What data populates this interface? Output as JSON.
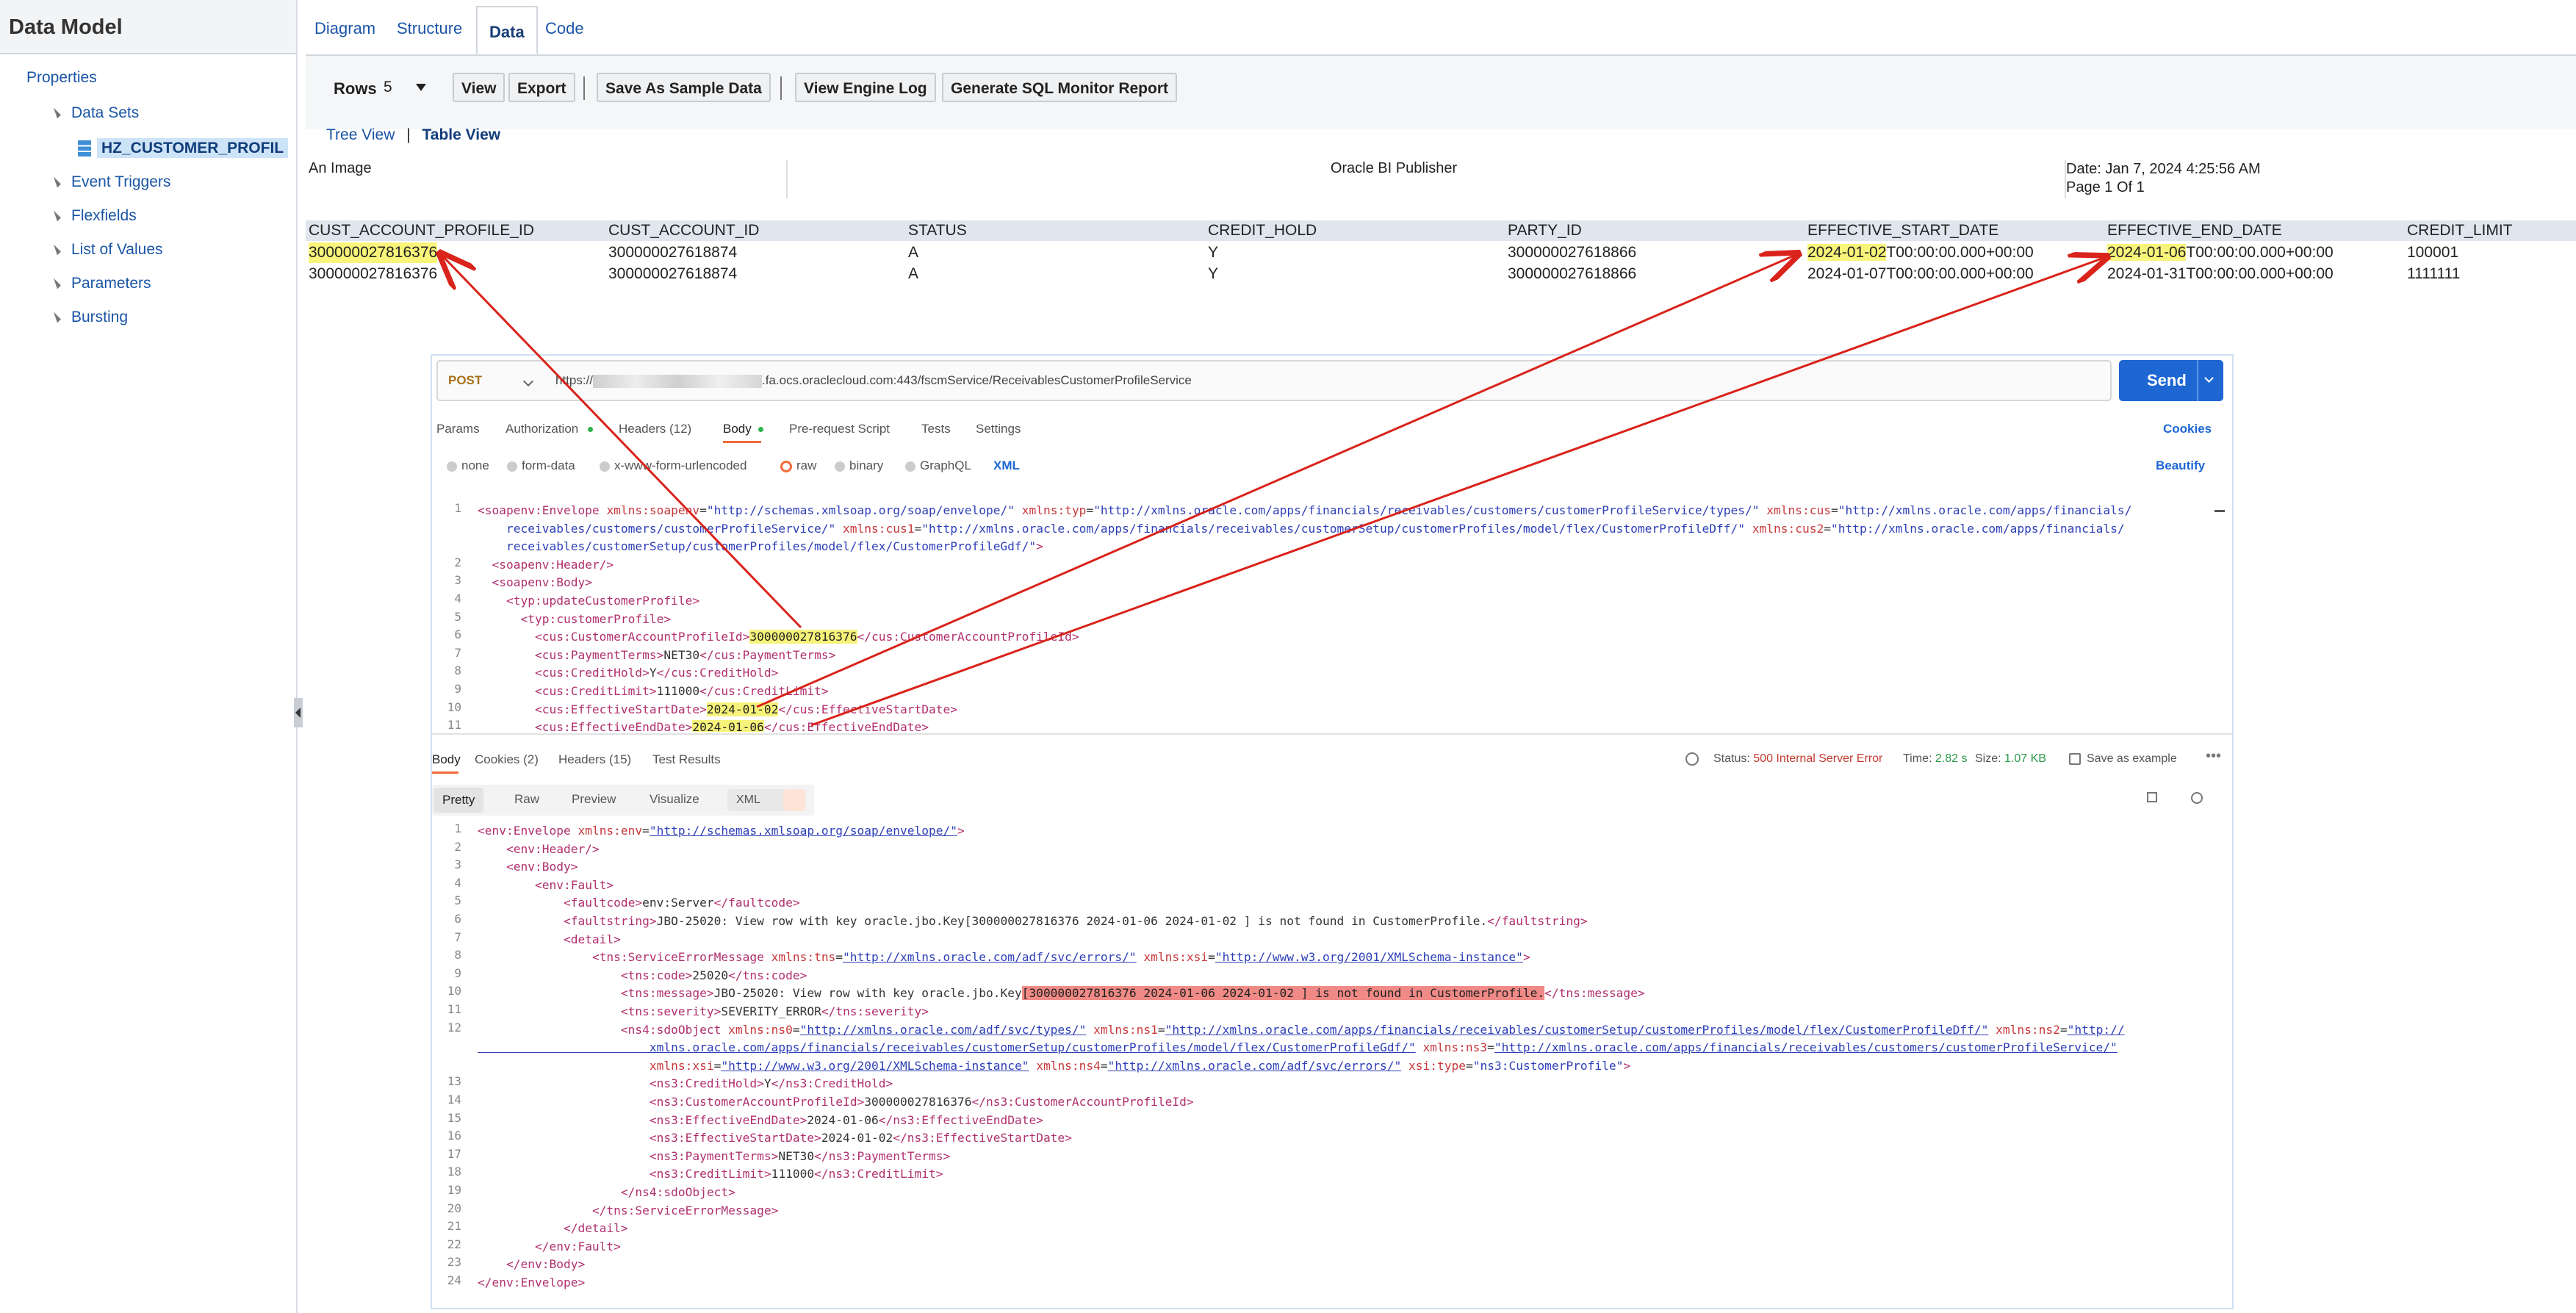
{
  "data_model": {
    "title": "Data Model",
    "properties": "Properties",
    "tree": [
      {
        "label": "Data Sets"
      },
      {
        "label": "HZ_CUSTOMER_PROFIL"
      },
      {
        "label": "Event Triggers"
      },
      {
        "label": "Flexfields"
      },
      {
        "label": "List of Values"
      },
      {
        "label": "Parameters"
      },
      {
        "label": "Bursting"
      }
    ]
  },
  "tabs": [
    "Diagram",
    "Structure",
    "Data",
    "Code"
  ],
  "toolbar": {
    "rows_label": "Rows",
    "rows_value": "5",
    "buttons": [
      "View",
      "Export",
      "Save As Sample Data",
      "View Engine Log",
      "Generate SQL Monitor Report"
    ]
  },
  "view_toggle": {
    "tree": "Tree View",
    "sep": "|",
    "table": "Table View"
  },
  "report": {
    "left": "An Image",
    "center": "Oracle BI Publisher",
    "date": "Date: Jan 7, 2024 4:25:56 AM",
    "page": "Page 1 Of 1"
  },
  "grid": {
    "headers": [
      "CUST_ACCOUNT_PROFILE_ID",
      "CUST_ACCOUNT_ID",
      "STATUS",
      "CREDIT_HOLD",
      "PARTY_ID",
      "EFFECTIVE_START_DATE",
      "EFFECTIVE_END_DATE",
      "CREDIT_LIMIT"
    ],
    "rows": [
      [
        "300000027816376",
        "300000027618874",
        "A",
        "Y",
        "300000027618866",
        "2024-01-02",
        "T00:00:00.000+00:00",
        "2024-01-06",
        "T00:00:00.000+00:00",
        "100001"
      ],
      [
        "300000027816376",
        "300000027618874",
        "A",
        "Y",
        "300000027618866",
        "2024-01-07T00:00:00.000+00:00",
        "",
        "2024-01-31T00:00:00.000+00:00",
        "",
        "1111111"
      ]
    ]
  },
  "postman": {
    "method": "POST",
    "url_prefix": "https://",
    "url_suffix": ".fa.ocs.oraclecloud.com:443/fscmService/ReceivablesCustomerProfileService",
    "send": "Send",
    "req_tabs": [
      "Params",
      "Authorization",
      "Headers (12)",
      "Body",
      "Pre-request Script",
      "Tests",
      "Settings"
    ],
    "cookies": "Cookies",
    "body_types": [
      "none",
      "form-data",
      "x-www-form-urlencoded",
      "raw",
      "binary",
      "GraphQL"
    ],
    "body_lang": "XML",
    "beautify": "Beautify",
    "resp_tabs": [
      "Body",
      "Cookies (2)",
      "Headers (15)",
      "Test Results"
    ],
    "status_label": "Status:",
    "status_value": "500 Internal Server Error",
    "time_label": "Time:",
    "time_value": "2.82 s",
    "size_label": "Size:",
    "size_value": "1.07 KB",
    "save_example": "Save as example",
    "view_tabs": [
      "Pretty",
      "Raw",
      "Preview",
      "Visualize"
    ],
    "resp_lang": "XML",
    "request_lines": [
      {
        "n": "1",
        "tokens": [
          [
            "tag",
            "<soapenv:Envelope "
          ],
          [
            "attr",
            "xmlns:soapenv"
          ],
          [
            "txt",
            "="
          ],
          [
            "val",
            "\"http://schemas.xmlsoap.org/soap/envelope/\""
          ],
          [
            "txt",
            " "
          ],
          [
            "attr",
            "xmlns:typ"
          ],
          [
            "txt",
            "="
          ],
          [
            "val",
            "\"http://xmlns.oracle.com/apps/financials/receivables/customers/customerProfileService/types/\""
          ],
          [
            "txt",
            " "
          ],
          [
            "attr",
            "xmlns:cus"
          ],
          [
            "txt",
            "="
          ],
          [
            "val",
            "\"http://xmlns.oracle.com/apps/financials/"
          ]
        ]
      },
      {
        "n": "",
        "tokens": [
          [
            "val",
            "    receivables/customers/customerProfileService/\""
          ],
          [
            "txt",
            " "
          ],
          [
            "attr",
            "xmlns:cus1"
          ],
          [
            "txt",
            "="
          ],
          [
            "val",
            "\"http://xmlns.oracle.com/apps/financials/receivables/customerSetup/customerProfiles/model/flex/CustomerProfileDff/\""
          ],
          [
            "txt",
            " "
          ],
          [
            "attr",
            "xmlns:cus2"
          ],
          [
            "txt",
            "="
          ],
          [
            "val",
            "\"http://xmlns.oracle.com/apps/financials/"
          ]
        ]
      },
      {
        "n": "",
        "tokens": [
          [
            "val",
            "    receivables/customerSetup/customerProfiles/model/flex/CustomerProfileGdf/\""
          ],
          [
            "tag",
            ">"
          ]
        ]
      },
      {
        "n": "2",
        "tokens": [
          [
            "txt",
            "  "
          ],
          [
            "tag",
            "<soapenv:Header/>"
          ]
        ]
      },
      {
        "n": "3",
        "tokens": [
          [
            "txt",
            "  "
          ],
          [
            "tag",
            "<soapenv:Body>"
          ]
        ]
      },
      {
        "n": "4",
        "tokens": [
          [
            "txt",
            "    "
          ],
          [
            "tag",
            "<typ:updateCustomerProfile>"
          ]
        ]
      },
      {
        "n": "5",
        "tokens": [
          [
            "txt",
            "      "
          ],
          [
            "tag",
            "<typ:customerProfile>"
          ]
        ]
      },
      {
        "n": "6",
        "tokens": [
          [
            "txt",
            "        "
          ],
          [
            "tag",
            "<cus:CustomerAccountProfileId>"
          ],
          [
            "hl",
            "300000027816376"
          ],
          [
            "tag",
            "</cus:CustomerAccountProfileId>"
          ]
        ]
      },
      {
        "n": "7",
        "tokens": [
          [
            "txt",
            "        "
          ],
          [
            "tag",
            "<cus:PaymentTerms>"
          ],
          [
            "txt",
            "NET30"
          ],
          [
            "tag",
            "</cus:PaymentTerms>"
          ]
        ]
      },
      {
        "n": "8",
        "tokens": [
          [
            "txt",
            "        "
          ],
          [
            "tag",
            "<cus:CreditHold>"
          ],
          [
            "txt",
            "Y"
          ],
          [
            "tag",
            "</cus:CreditHold>"
          ]
        ]
      },
      {
        "n": "9",
        "tokens": [
          [
            "txt",
            "        "
          ],
          [
            "tag",
            "<cus:CreditLimit>"
          ],
          [
            "txt",
            "111000"
          ],
          [
            "tag",
            "</cus:CreditLimit>"
          ]
        ]
      },
      {
        "n": "10",
        "tokens": [
          [
            "txt",
            "        "
          ],
          [
            "tag",
            "<cus:EffectiveStartDate>"
          ],
          [
            "hl",
            "2024-01-02"
          ],
          [
            "tag",
            "</cus:EffectiveStartDate>"
          ]
        ]
      },
      {
        "n": "11",
        "tokens": [
          [
            "txt",
            "        "
          ],
          [
            "tag",
            "<cus:EffectiveEndDate>"
          ],
          [
            "hl",
            "2024-01-06"
          ],
          [
            "tag",
            "</cus:EffectiveEndDate>"
          ]
        ]
      }
    ],
    "response_lines": [
      {
        "n": "1",
        "tokens": [
          [
            "tag",
            "<env:Envelope "
          ],
          [
            "attr",
            "xmlns:env"
          ],
          [
            "txt",
            "="
          ],
          [
            "url",
            "\"http://schemas.xmlsoap.org/soap/envelope/\""
          ],
          [
            "tag",
            ">"
          ]
        ]
      },
      {
        "n": "2",
        "tokens": [
          [
            "txt",
            "    "
          ],
          [
            "tag",
            "<env:Header/>"
          ]
        ]
      },
      {
        "n": "3",
        "tokens": [
          [
            "txt",
            "    "
          ],
          [
            "tag",
            "<env:Body>"
          ]
        ]
      },
      {
        "n": "4",
        "tokens": [
          [
            "txt",
            "        "
          ],
          [
            "tag",
            "<env:Fault>"
          ]
        ]
      },
      {
        "n": "5",
        "tokens": [
          [
            "txt",
            "            "
          ],
          [
            "tag",
            "<faultcode>"
          ],
          [
            "txt",
            "env:Server"
          ],
          [
            "tag",
            "</faultcode>"
          ]
        ]
      },
      {
        "n": "6",
        "tokens": [
          [
            "txt",
            "            "
          ],
          [
            "tag",
            "<faultstring>"
          ],
          [
            "txt",
            "JBO-25020: View row with key oracle.jbo.Key[300000027816376 2024-01-06 2024-01-02 ] is not found in CustomerProfile."
          ],
          [
            "tag",
            "</faultstring>"
          ]
        ]
      },
      {
        "n": "7",
        "tokens": [
          [
            "txt",
            "            "
          ],
          [
            "tag",
            "<detail>"
          ]
        ]
      },
      {
        "n": "8",
        "tokens": [
          [
            "txt",
            "                "
          ],
          [
            "tag",
            "<tns:ServiceErrorMessage "
          ],
          [
            "attr",
            "xmlns:tns"
          ],
          [
            "txt",
            "="
          ],
          [
            "url",
            "\"http://xmlns.oracle.com/adf/svc/errors/\""
          ],
          [
            "txt",
            " "
          ],
          [
            "attr",
            "xmlns:xsi"
          ],
          [
            "txt",
            "="
          ],
          [
            "url",
            "\"http://www.w3.org/2001/XMLSchema-instance\""
          ],
          [
            "tag",
            ">"
          ]
        ]
      },
      {
        "n": "9",
        "tokens": [
          [
            "txt",
            "                    "
          ],
          [
            "tag",
            "<tns:code>"
          ],
          [
            "txt",
            "25020"
          ],
          [
            "tag",
            "</tns:code>"
          ]
        ]
      },
      {
        "n": "10",
        "tokens": [
          [
            "txt",
            "                    "
          ],
          [
            "tag",
            "<tns:message>"
          ],
          [
            "txt",
            "JBO-25020: View row with key oracle.jbo.Key"
          ],
          [
            "err",
            "[300000027816376 2024-01-06 2024-01-02 ] is not found in CustomerProfile."
          ],
          [
            "tag",
            "</tns:message>"
          ]
        ]
      },
      {
        "n": "11",
        "tokens": [
          [
            "txt",
            "                    "
          ],
          [
            "tag",
            "<tns:severity>"
          ],
          [
            "txt",
            "SEVERITY_ERROR"
          ],
          [
            "tag",
            "</tns:severity>"
          ]
        ]
      },
      {
        "n": "12",
        "tokens": [
          [
            "txt",
            "                    "
          ],
          [
            "tag",
            "<ns4:sdoObject "
          ],
          [
            "attr",
            "xmlns:ns0"
          ],
          [
            "txt",
            "="
          ],
          [
            "url",
            "\"http://xmlns.oracle.com/adf/svc/types/\""
          ],
          [
            "txt",
            " "
          ],
          [
            "attr",
            "xmlns:ns1"
          ],
          [
            "txt",
            "="
          ],
          [
            "url",
            "\"http://xmlns.oracle.com/apps/financials/receivables/customerSetup/customerProfiles/model/flex/CustomerProfileDff/\""
          ],
          [
            "txt",
            " "
          ],
          [
            "attr",
            "xmlns:ns2"
          ],
          [
            "txt",
            "="
          ],
          [
            "url",
            "\"http://"
          ]
        ]
      },
      {
        "n": "",
        "tokens": [
          [
            "url",
            "                        xmlns.oracle.com/apps/financials/receivables/customerSetup/customerProfiles/model/flex/CustomerProfileGdf/\""
          ],
          [
            "txt",
            " "
          ],
          [
            "attr",
            "xmlns:ns3"
          ],
          [
            "txt",
            "="
          ],
          [
            "url",
            "\"http://xmlns.oracle.com/apps/financials/receivables/customers/customerProfileService/\""
          ]
        ]
      },
      {
        "n": "",
        "tokens": [
          [
            "txt",
            "                        "
          ],
          [
            "attr",
            "xmlns:xsi"
          ],
          [
            "txt",
            "="
          ],
          [
            "url",
            "\"http://www.w3.org/2001/XMLSchema-instance\""
          ],
          [
            "txt",
            " "
          ],
          [
            "attr",
            "xmlns:ns4"
          ],
          [
            "txt",
            "="
          ],
          [
            "url",
            "\"http://xmlns.oracle.com/adf/svc/errors/\""
          ],
          [
            "txt",
            " "
          ],
          [
            "attr",
            "xsi:type"
          ],
          [
            "txt",
            "="
          ],
          [
            "val",
            "\"ns3:CustomerProfile\""
          ],
          [
            "tag",
            ">"
          ]
        ]
      },
      {
        "n": "13",
        "tokens": [
          [
            "txt",
            "                        "
          ],
          [
            "tag",
            "<ns3:CreditHold>"
          ],
          [
            "txt",
            "Y"
          ],
          [
            "tag",
            "</ns3:CreditHold>"
          ]
        ]
      },
      {
        "n": "14",
        "tokens": [
          [
            "txt",
            "                        "
          ],
          [
            "tag",
            "<ns3:CustomerAccountProfileId>"
          ],
          [
            "txt",
            "300000027816376"
          ],
          [
            "tag",
            "</ns3:CustomerAccountProfileId>"
          ]
        ]
      },
      {
        "n": "15",
        "tokens": [
          [
            "txt",
            "                        "
          ],
          [
            "tag",
            "<ns3:EffectiveEndDate>"
          ],
          [
            "txt",
            "2024-01-06"
          ],
          [
            "tag",
            "</ns3:EffectiveEndDate>"
          ]
        ]
      },
      {
        "n": "16",
        "tokens": [
          [
            "txt",
            "                        "
          ],
          [
            "tag",
            "<ns3:EffectiveStartDate>"
          ],
          [
            "txt",
            "2024-01-02"
          ],
          [
            "tag",
            "</ns3:EffectiveStartDate>"
          ]
        ]
      },
      {
        "n": "17",
        "tokens": [
          [
            "txt",
            "                        "
          ],
          [
            "tag",
            "<ns3:PaymentTerms>"
          ],
          [
            "txt",
            "NET30"
          ],
          [
            "tag",
            "</ns3:PaymentTerms>"
          ]
        ]
      },
      {
        "n": "18",
        "tokens": [
          [
            "txt",
            "                        "
          ],
          [
            "tag",
            "<ns3:CreditLimit>"
          ],
          [
            "txt",
            "111000"
          ],
          [
            "tag",
            "</ns3:CreditLimit>"
          ]
        ]
      },
      {
        "n": "19",
        "tokens": [
          [
            "txt",
            "                    "
          ],
          [
            "tag",
            "</ns4:sdoObject>"
          ]
        ]
      },
      {
        "n": "20",
        "tokens": [
          [
            "txt",
            "                "
          ],
          [
            "tag",
            "</tns:ServiceErrorMessage>"
          ]
        ]
      },
      {
        "n": "21",
        "tokens": [
          [
            "txt",
            "            "
          ],
          [
            "tag",
            "</detail>"
          ]
        ]
      },
      {
        "n": "22",
        "tokens": [
          [
            "txt",
            "        "
          ],
          [
            "tag",
            "</env:Fault>"
          ]
        ]
      },
      {
        "n": "23",
        "tokens": [
          [
            "txt",
            "    "
          ],
          [
            "tag",
            "</env:Body>"
          ]
        ]
      },
      {
        "n": "24",
        "tokens": [
          [
            "tag",
            "</env:Envelope>"
          ]
        ]
      }
    ]
  },
  "colors": {
    "accent": "#1e67d3",
    "highlight": "#f8f57a",
    "error_highlight": "#f08a86",
    "arrow": "#d9231b"
  }
}
